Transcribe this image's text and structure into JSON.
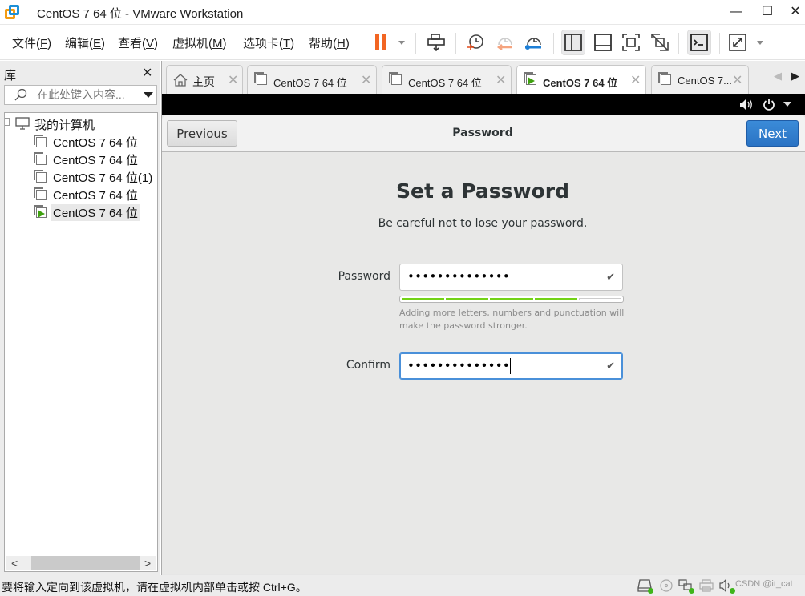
{
  "window": {
    "title": "CentOS 7 64 位 - VMware Workstation",
    "minimize": "—",
    "maximize": "☐",
    "close": "✕"
  },
  "menubar": {
    "items": [
      {
        "label": "文件(",
        "key": "F",
        "end": ")"
      },
      {
        "label": "编辑(",
        "key": "E",
        "end": ")"
      },
      {
        "label": "查看(",
        "key": "V",
        "end": ")"
      },
      {
        "label": "虚拟机(",
        "key": "M",
        "end": ")"
      },
      {
        "label": "选项卡(",
        "key": "T",
        "end": ")"
      },
      {
        "label": "帮助(",
        "key": "H",
        "end": ")"
      }
    ]
  },
  "toolbar": {
    "icons": [
      "pause-icon",
      "send-keys-icon",
      "snapshot-take-icon",
      "snapshot-revert-icon",
      "snapshot-manager-icon",
      "library-view-icon",
      "thumbnail-bar-icon",
      "fullscreen-icon",
      "unity-icon",
      "console-icon",
      "stretch-icon"
    ],
    "accent_pause": "#f26522"
  },
  "sidebar": {
    "title": "库",
    "close": "✕",
    "search_placeholder": "在此处键入内容...",
    "root": "我的计算机",
    "items": [
      {
        "label": "CentOS 7 64 位",
        "running": false
      },
      {
        "label": "CentOS 7 64 位",
        "running": false
      },
      {
        "label": "CentOS 7 64 位(1)",
        "running": false
      },
      {
        "label": "CentOS 7 64 位",
        "running": false
      },
      {
        "label": "CentOS 7 64 位",
        "running": true
      }
    ],
    "scroll_left": "<",
    "scroll_right": ">"
  },
  "tabs": [
    {
      "label": "主页",
      "icon": "home-icon",
      "active": false
    },
    {
      "label": "CentOS 7 64 位",
      "icon": "vm-icon",
      "active": false
    },
    {
      "label": "CentOS 7 64 位",
      "icon": "vm-icon",
      "active": false
    },
    {
      "label": "CentOS 7 64 位",
      "icon": "vm-running-icon",
      "active": true
    },
    {
      "label": "CentOS 7...",
      "icon": "vm-icon",
      "active": false
    }
  ],
  "tab_close": "✕",
  "tab_nav": {
    "prev": "◀",
    "next": "▶"
  },
  "guest_topbar": {
    "volume": "🔊",
    "power": "⏻",
    "menu": "▼"
  },
  "installer": {
    "header_title": "Password",
    "previous_label": "Previous",
    "next_label": "Next",
    "heading": "Set a Password",
    "subheading": "Be careful not to lose your password.",
    "password_label": "Password",
    "password_value": "••••••••••••••",
    "confirm_label": "Confirm",
    "confirm_value": "••••••••••••••",
    "check": "✔",
    "strength_segments_filled": 4,
    "strength_segments_total": 5,
    "strength_color": "#73d216",
    "hint": "Adding more letters, numbers and punctuation will make the password stronger."
  },
  "statusbar": {
    "message": "要将输入定向到该虚拟机，请在虚拟机内部单击或按 Ctrl+G。",
    "device_icons": [
      "hard-disk-icon",
      "cd-dvd-icon",
      "network-adapter-icon",
      "printer-icon",
      "sound-card-icon",
      "usb-icon"
    ],
    "watermark": "CSDN @it_cat"
  }
}
